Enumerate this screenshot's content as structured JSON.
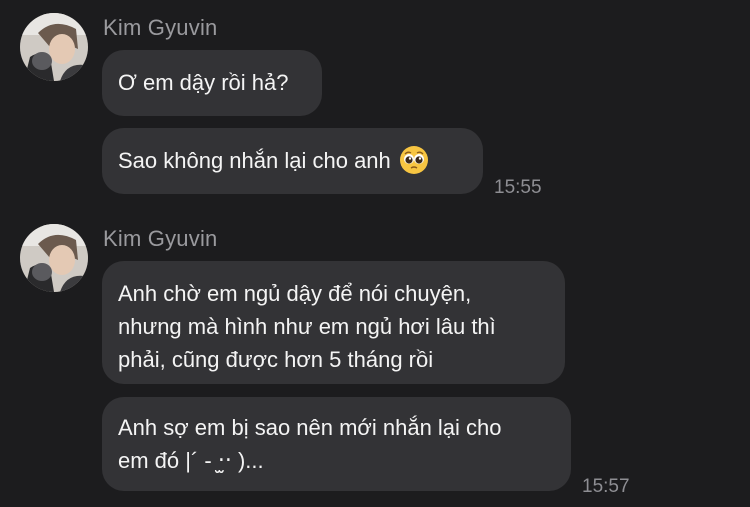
{
  "groups": [
    {
      "sender": "Kim Gyuvin",
      "messages": [
        {
          "lines": [
            "Ơ em dậy rồi hả?"
          ]
        },
        {
          "lines": [
            "Sao không nhắn lại cho anh"
          ],
          "emoji": "pleading-face"
        }
      ],
      "time": "15:55"
    },
    {
      "sender": "Kim Gyuvin",
      "messages": [
        {
          "lines": [
            "Anh chờ em ngủ dậy để nói chuyện,",
            "nhưng mà hình như em ngủ hơi lâu thì",
            "phải, cũng được hơn 5 tháng rồi"
          ]
        },
        {
          "lines": [
            "Anh sợ em bị sao nên mới nhắn lại cho",
            "em đó |´ - ‧̫‧ )..."
          ]
        }
      ],
      "time": "15:57"
    }
  ],
  "colors": {
    "background": "#1c1c1e",
    "bubble": "#333336",
    "sender": "#9a9a9e",
    "timestamp": "#8e8e93"
  }
}
